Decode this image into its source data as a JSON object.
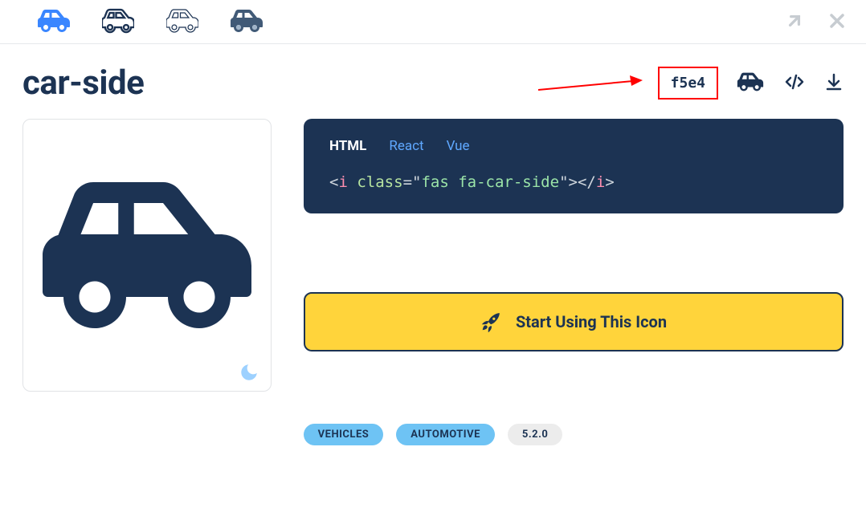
{
  "icon_name": "car-side",
  "unicode": "f5e4",
  "style_variants": [
    "solid",
    "regular",
    "light",
    "duotone"
  ],
  "code_tabs": {
    "html": "HTML",
    "react": "React",
    "vue": "Vue",
    "active": "html"
  },
  "code_snippet": {
    "tag": "i",
    "attr_name": "class",
    "attr_value": "fas fa-car-side"
  },
  "cta_label": "Start Using This Icon",
  "tags": {
    "vehicles": "VEHICLES",
    "automotive": "AUTOMOTIVE"
  },
  "version": "5.2.0",
  "colors": {
    "navy": "#1c3353",
    "yellow": "#ffd43b",
    "light_blue": "#6ec3f4",
    "accent_blue": "#3a86ff",
    "red": "#ff0000"
  }
}
